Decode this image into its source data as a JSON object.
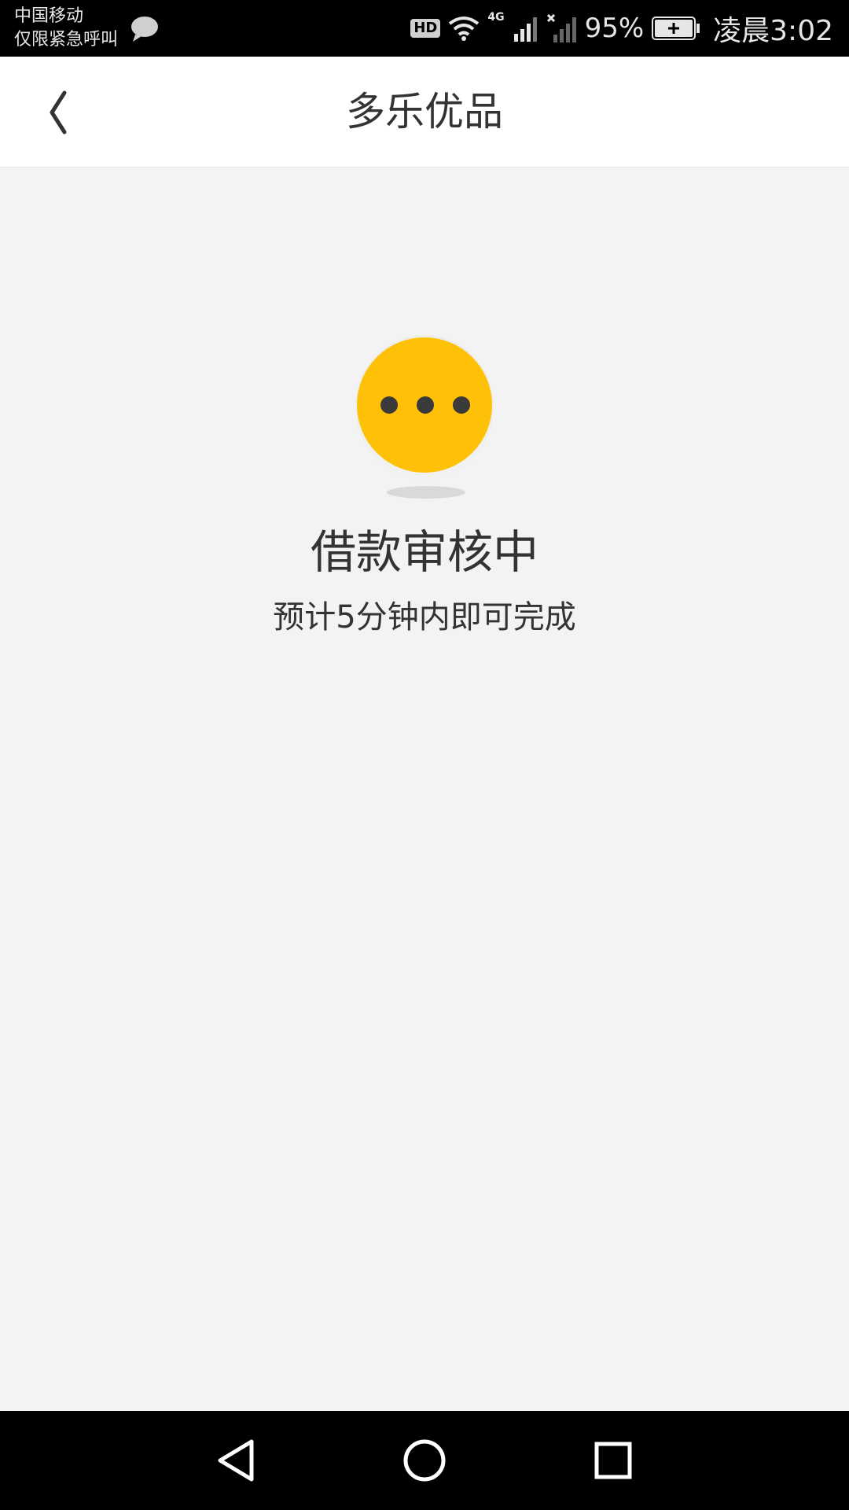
{
  "status_bar": {
    "carrier_line1": "中国移动",
    "carrier_line2": "仅限紧急呼叫",
    "hd": "HD",
    "network": "4G",
    "battery_percent": "95%",
    "time": "凌晨3:02"
  },
  "header": {
    "title": "多乐优品",
    "back_icon": "chevron-left-icon"
  },
  "main": {
    "status_icon": "loading-dots-face-icon",
    "heading": "借款审核中",
    "subtext": "预计5分钟内即可完成"
  },
  "nav_bar": {
    "back": "triangle-back-icon",
    "home": "circle-home-icon",
    "recent": "square-recent-icon"
  },
  "colors": {
    "accent": "#FFC107",
    "text": "#333333",
    "background": "#F3F3F3"
  }
}
